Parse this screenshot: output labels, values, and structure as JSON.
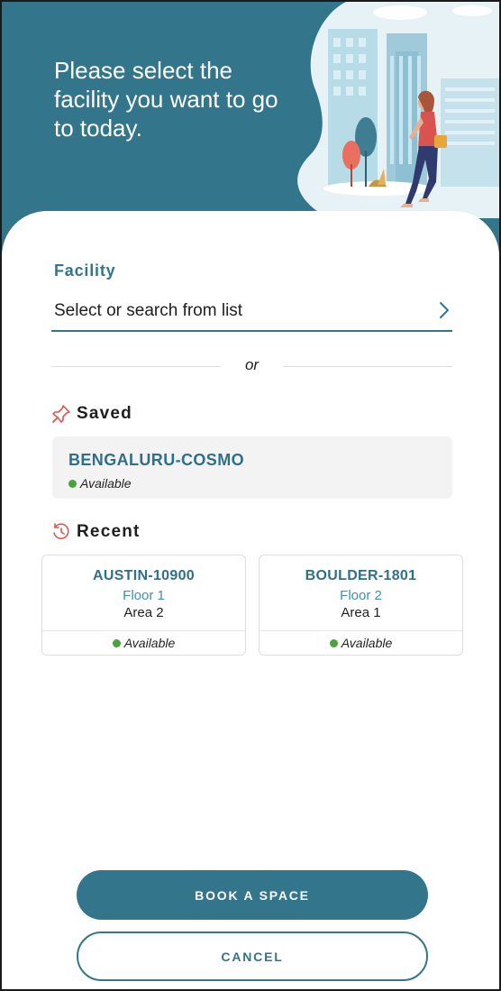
{
  "header": {
    "title": "Please select the\nfacility you want to go\nto today."
  },
  "facility": {
    "label": "Facility",
    "placeholder": "Select or search from list",
    "chevron_icon": "chevron-right-icon"
  },
  "divider": {
    "text": "or"
  },
  "saved": {
    "heading": "Saved",
    "icon": "pin-icon",
    "item": {
      "name": "BENGALURU-COSMO",
      "status": "Available"
    }
  },
  "recent": {
    "heading": "Recent",
    "icon": "history-clock-icon",
    "items": [
      {
        "name": "AUSTIN-10900",
        "floor": "Floor 1",
        "area": "Area 2",
        "status": "Available"
      },
      {
        "name": "BOULDER-1801",
        "floor": "Floor 2",
        "area": "Area 1",
        "status": "Available"
      }
    ]
  },
  "actions": {
    "primary_label": "BOOK A SPACE",
    "secondary_label": "CANCEL"
  },
  "colors": {
    "brand": "#33758b",
    "available": "#4aa43a",
    "accent_icon": "#e0564d"
  }
}
